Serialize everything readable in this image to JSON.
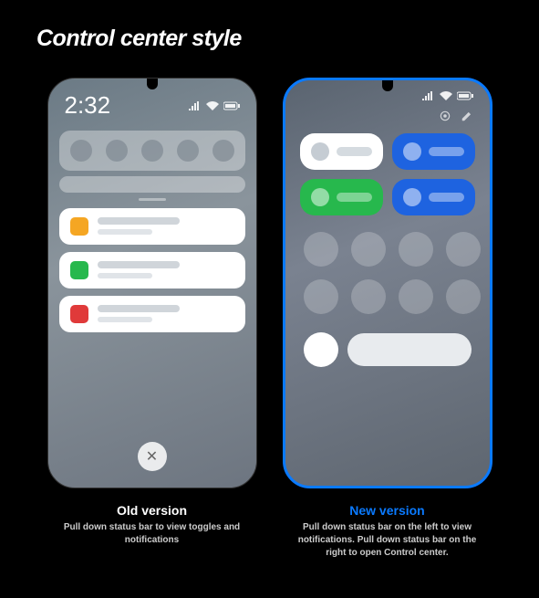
{
  "title": "Control center style",
  "old": {
    "clock": "2:32",
    "caption_title": "Old version",
    "caption_desc": "Pull down status bar to view toggles and notifications",
    "notif_colors": [
      "#f5a623",
      "#27b84d",
      "#e03a3a"
    ]
  },
  "new": {
    "caption_title": "New version",
    "caption_desc": "Pull down status bar on the left to view notifications. Pull down status bar on the right to open Control center.",
    "tiles": [
      {
        "style": "white"
      },
      {
        "style": "blue"
      },
      {
        "style": "green"
      },
      {
        "style": "blue"
      }
    ],
    "circle_count": 8
  },
  "colors": {
    "accent": "#0a7aff"
  }
}
